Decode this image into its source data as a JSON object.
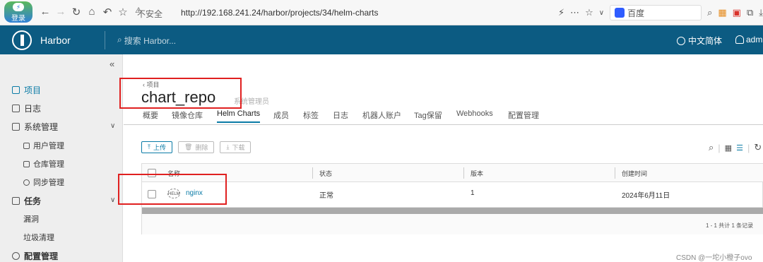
{
  "browser": {
    "login_label": "登录",
    "insecure_label": "不安全",
    "url": "http://192.168.241.24/harbor/projects/34/helm-charts",
    "search_engine": "百度"
  },
  "header": {
    "brand": "Harbor",
    "search_placeholder": "搜索 Harbor...",
    "language": "中文简体",
    "user": "admin"
  },
  "sidebar": {
    "items": {
      "projects": "项目",
      "logs": "日志",
      "admin": "系统管理",
      "users": "用户管理",
      "registries": "仓库管理",
      "replications": "同步管理",
      "tasks": "任务",
      "vulnerability": "漏洞",
      "gc": "垃圾清理",
      "config": "配置管理"
    }
  },
  "project": {
    "breadcrumb": "‹ 项目",
    "name": "chart_repo",
    "role": "系统管理员",
    "tabs": [
      "概要",
      "镜像仓库",
      "Helm Charts",
      "成员",
      "标签",
      "日志",
      "机器人账户",
      "Tag保留",
      "Webhooks",
      "配置管理"
    ],
    "active_tab": "Helm Charts"
  },
  "toolbar": {
    "upload": "上传",
    "delete": "删除",
    "download": "下载"
  },
  "table": {
    "columns": [
      "名称",
      "状态",
      "版本",
      "创建时间"
    ],
    "rows": [
      {
        "name": "nginx",
        "status": "正常",
        "version": "1",
        "created": "2024年6月11日"
      }
    ],
    "pager": "1 - 1 共计 1 条记录"
  },
  "watermark": "CSDN @一坨小橙子ovo",
  "colors": {
    "header": "#0c5b82",
    "accent": "#0b7ba6",
    "highlight": "#e02020"
  }
}
